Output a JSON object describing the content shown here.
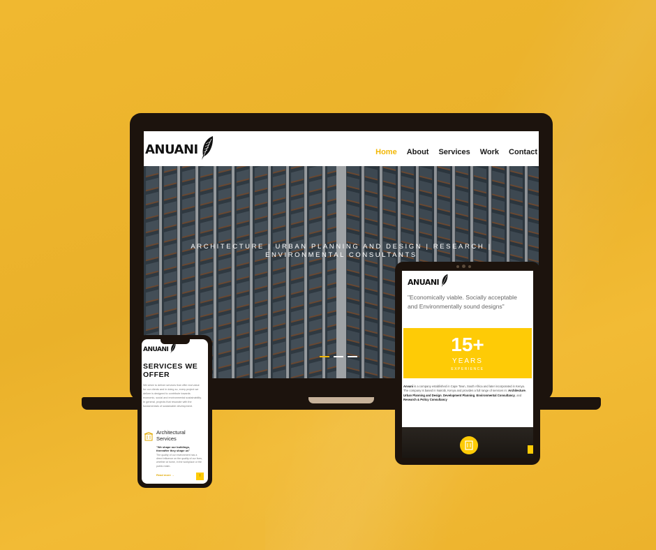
{
  "brand": {
    "logo_text": "ANUANI"
  },
  "nav": {
    "items": [
      {
        "label": "Home",
        "active": true
      },
      {
        "label": "About",
        "active": false
      },
      {
        "label": "Services",
        "active": false
      },
      {
        "label": "Work",
        "active": false
      },
      {
        "label": "Contact",
        "active": false
      }
    ]
  },
  "hero": {
    "tagline": "ARCHITECTURE | URBAN PLANNING AND DESIGN | RESEARCH | ENVIRONMENTAL CONSULTANTS",
    "slide_count": 3,
    "active_slide": 1
  },
  "tablet": {
    "quote": "\"Economically viable. Socially acceptable and Environmentally sound designs\"",
    "years_number": "15+",
    "years_label": "YEARS",
    "experience_label": "EXPERIENCE",
    "about": {
      "company": "Anvani",
      "text1": " is a company established in Cape Town, South Africa and later incorporated in Kenya. The company is based in Nairobi, Kenya and provides a full range of services in: ",
      "svc1": "Architecture",
      "sep1": ", ",
      "svc2": "Urban Planning and Design",
      "sep2": ", ",
      "svc3": "Development Planning",
      "sep3": ", ",
      "svc4": "Environmental Consultancy",
      "sep4": ", and ",
      "svc5": "Research & Policy Consultancy"
    }
  },
  "phone": {
    "heading": "SERVICES WE OFFER",
    "paragraph": "We strive to deliver services that offer real value for our clients and in doing so, every project we deliver is designed to contribute towards economic, social and environmental sustainability. In general, projects that resonate with the fundamentals of sustainable development.",
    "service_title": "Architectural Services",
    "service_quote": "\"We shape our buildings, thereafter they shape us\"",
    "service_text": "The quality of our environment has a direct influence on the quality of our lives, whether at home, in the workplace or the public realm.",
    "read_more": "Read more →",
    "top_button": "↑"
  },
  "colors": {
    "accent": "#fecb06",
    "device": "#1c130d",
    "background": "#eeb42c"
  },
  "icons": {
    "logo": "feather-icon",
    "service": "building-icon"
  }
}
